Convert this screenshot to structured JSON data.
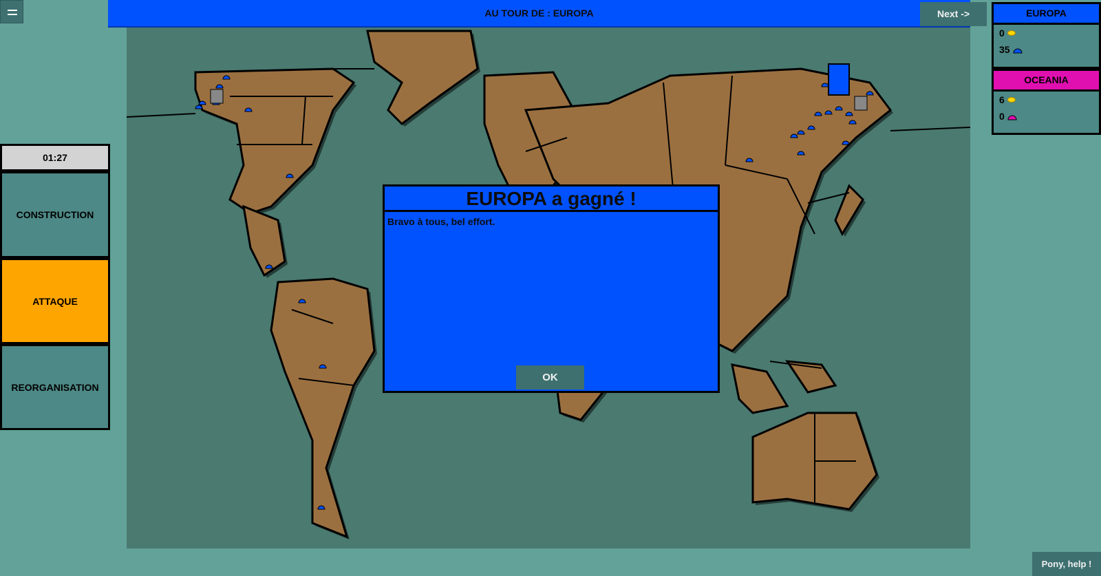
{
  "header": {
    "turn_text": "AU TOUR DE : EUROPA",
    "next_label": "Next  ->"
  },
  "timer": "01:27",
  "phases": [
    {
      "label": "CONSTRUCTION",
      "active": false
    },
    {
      "label": "ATTAQUE",
      "active": true
    },
    {
      "label": "REORGANISATION",
      "active": false
    }
  ],
  "players": [
    {
      "name": "EUROPA",
      "color": "#0052ff",
      "gold": "0",
      "troops": "35",
      "troop_icon": "helmet-icon"
    },
    {
      "name": "OCEANIA",
      "color": "#e010b0",
      "gold": "6",
      "troops": "0",
      "troop_icon": "helmet-icon"
    }
  ],
  "modal": {
    "title": "EUROPA a gagné !",
    "message": "Bravo à tous, bel effort.",
    "ok_label": "OK"
  },
  "help_label": "Pony, help !",
  "colors": {
    "ocean": "#4a7a70",
    "land": "#9b7040",
    "europa": "#0052ff",
    "oceania": "#e010b0",
    "active_phase": "#ffa500"
  }
}
